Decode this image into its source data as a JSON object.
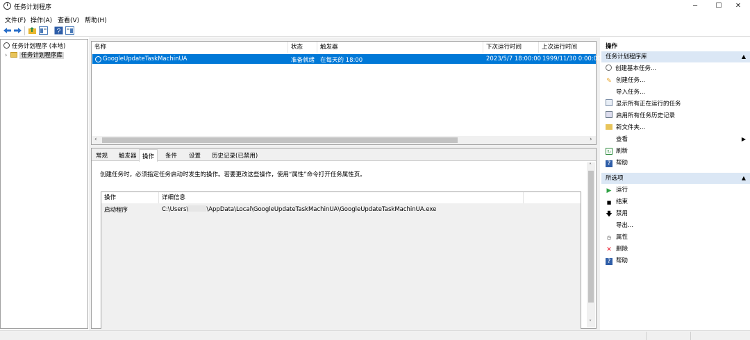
{
  "window": {
    "title": "任务计划程序",
    "minimize": "─",
    "maximize": "☐",
    "close": "✕"
  },
  "menu": {
    "file": "文件(F)",
    "action": "操作(A)",
    "view": "查看(V)",
    "help": "帮助(H)"
  },
  "tree": {
    "root": "任务计划程序 (本地)",
    "library": "任务计划程序库"
  },
  "tasklist": {
    "columns": {
      "name": "名称",
      "status": "状态",
      "trigger": "触发器",
      "next_run": "下次运行时间",
      "last_run": "上次运行时间"
    },
    "row": {
      "name": "GoogleUpdateTaskMachinUA",
      "status": "准备就绪",
      "trigger": "在每天的 18:00",
      "next_run": "2023/5/7 18:00:00",
      "last_run": "1999/11/30 0:00:00"
    }
  },
  "tabs": {
    "general": "常规",
    "triggers": "触发器",
    "actions": "操作",
    "conditions": "条件",
    "settings": "设置",
    "history": "历史记录(已禁用)"
  },
  "actions_tab": {
    "description": "创建任务时，必须指定任务启动时发生的操作。若要更改这些操作，使用“属性”命令打开任务属性页。",
    "col_action": "操作",
    "col_detail": "详细信息",
    "row_action": "启动程序",
    "row_detail_prefix": "C:\\Users\\",
    "row_detail_suffix": "\\AppData\\Local\\GoogleUpdateTaskMachinUA\\GoogleUpdateTaskMachinUA.exe"
  },
  "right_pane": {
    "header": "操作",
    "section1": "任务计划程序库",
    "section1_items": [
      "创建基本任务...",
      "创建任务...",
      "导入任务...",
      "显示所有正在运行的任务",
      "启用所有任务历史记录",
      "新文件夹...",
      "查看",
      "刷新",
      "帮助"
    ],
    "section2": "所选项",
    "section2_items": [
      "运行",
      "结束",
      "禁用",
      "导出...",
      "属性",
      "删除",
      "帮助"
    ]
  },
  "colors": {
    "selection": "#0078d7",
    "section_header": "#dbe7f5",
    "delete_red": "#e81123",
    "run_green": "#2ea043"
  }
}
